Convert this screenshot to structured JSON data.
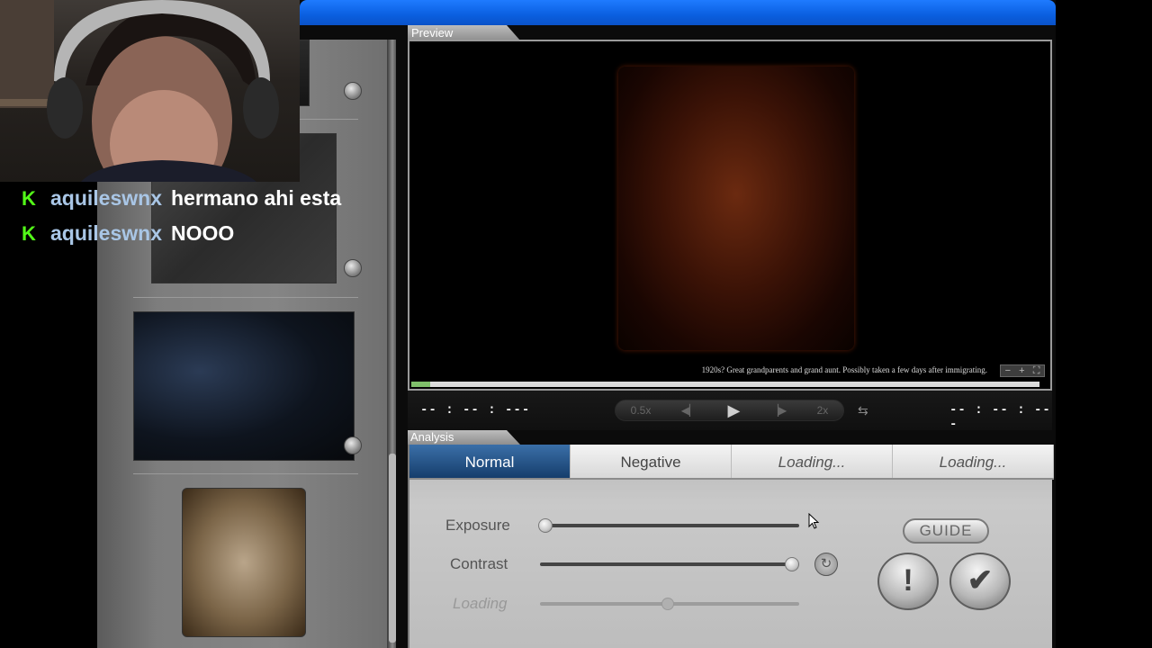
{
  "preview": {
    "tab_label": "Preview",
    "caption": "1920s? Great grandparents and grand aunt. Possibly taken a few days after immigrating.",
    "zoom_minus": "−",
    "zoom_plus": "+",
    "progress_fraction": 0.03
  },
  "transport": {
    "time_left": "-- : -- : ---",
    "time_right": "-- : -- : ---",
    "slow_label": "0.5x",
    "fast_label": "2x"
  },
  "analysis": {
    "tab_label": "Analysis",
    "tabs": [
      {
        "label": "Normal",
        "active": true
      },
      {
        "label": "Negative",
        "active": false
      },
      {
        "label": "Loading...",
        "active": false
      },
      {
        "label": "Loading...",
        "active": false
      }
    ],
    "sliders": [
      {
        "label": "Exposure",
        "value": 0.0
      },
      {
        "label": "Contrast",
        "value": 1.0
      },
      {
        "label": "Loading",
        "value": 0.5,
        "disabled": true
      }
    ],
    "guide_label": "GUIDE",
    "alert_label": "!",
    "confirm_label": "✔"
  },
  "chat": {
    "messages": [
      {
        "user": "aquileswnx",
        "text": "hermano ahi esta"
      },
      {
        "user": "aquileswnx",
        "text": "NOOO"
      }
    ]
  },
  "colors": {
    "titlebar": "#0a5fe0",
    "active_tab": "#1f4f85",
    "chat_icon": "#53fc18"
  }
}
